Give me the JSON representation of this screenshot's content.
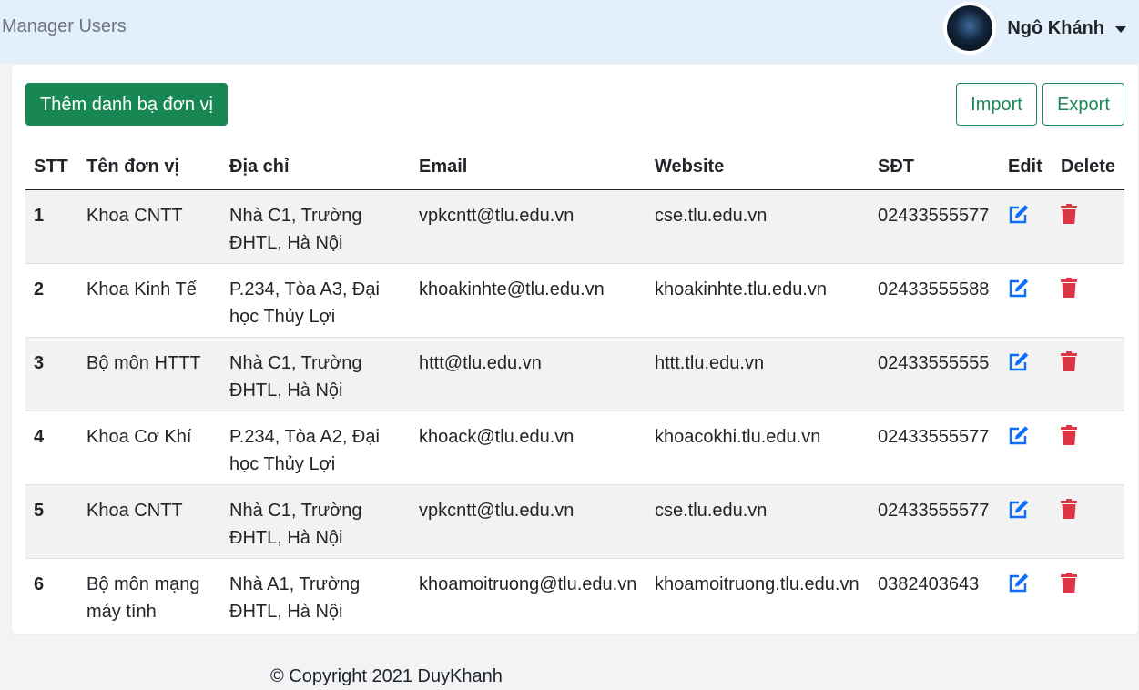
{
  "navbar": {
    "brand": "Manager Users",
    "user_name": "Ngô Khánh"
  },
  "toolbar": {
    "add_label": "Thêm danh bạ đơn vị",
    "import_label": "Import",
    "export_label": "Export"
  },
  "table": {
    "headers": [
      "STT",
      "Tên đơn vị",
      "Địa chỉ",
      "Email",
      "Website",
      "SĐT",
      "Edit",
      "Delete"
    ],
    "rows": [
      {
        "stt": "1",
        "name": "Khoa CNTT",
        "address": "Nhà C1, Trường ĐHTL, Hà Nội",
        "email": "vpkcntt@tlu.edu.vn",
        "website": "cse.tlu.edu.vn",
        "phone": "02433555577"
      },
      {
        "stt": "2",
        "name": "Khoa Kinh Tế",
        "address": "P.234, Tòa A3, Đại học Thủy Lợi",
        "email": "khoakinhte@tlu.edu.vn",
        "website": "khoakinhte.tlu.edu.vn",
        "phone": "02433555588"
      },
      {
        "stt": "3",
        "name": "Bộ môn HTTT",
        "address": "Nhà C1, Trường ĐHTL, Hà Nội",
        "email": "httt@tlu.edu.vn",
        "website": "httt.tlu.edu.vn",
        "phone": "02433555555"
      },
      {
        "stt": "4",
        "name": "Khoa Cơ Khí",
        "address": "P.234, Tòa A2, Đại học Thủy Lợi",
        "email": "khoack@tlu.edu.vn",
        "website": "khoacokhi.tlu.edu.vn",
        "phone": "02433555577"
      },
      {
        "stt": "5",
        "name": "Khoa CNTT",
        "address": "Nhà C1, Trường ĐHTL, Hà Nội",
        "email": "vpkcntt@tlu.edu.vn",
        "website": "cse.tlu.edu.vn",
        "phone": "02433555577"
      },
      {
        "stt": "6",
        "name": "Bộ môn mạng máy tính",
        "address": "Nhà A1, Trường ĐHTL, Hà Nội",
        "email": "khoamoitruong@tlu.edu.vn",
        "website": "khoamoitruong.tlu.edu.vn",
        "phone": "0382403643"
      }
    ]
  },
  "icons": {
    "edit": "edit-icon",
    "delete": "trash-icon"
  },
  "colors": {
    "primary_green": "#198754",
    "edit_blue": "#0d6efd",
    "delete_red": "#dc3545",
    "navbar_bg": "#e3f0fb"
  },
  "footer": {
    "copyright": "© Copyright 2021 DuyKhanh"
  }
}
